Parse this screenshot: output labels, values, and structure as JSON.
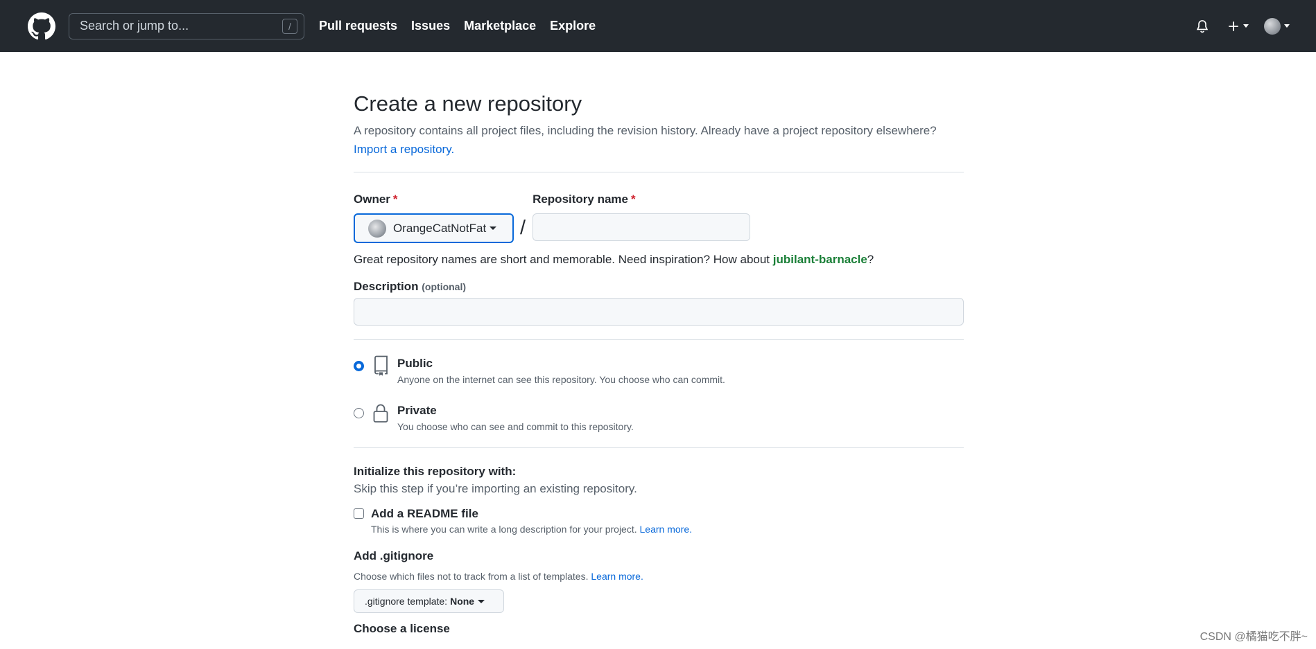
{
  "header": {
    "search_placeholder": "Search or jump to...",
    "search_shortcut": "/",
    "nav": [
      "Pull requests",
      "Issues",
      "Marketplace",
      "Explore"
    ],
    "plus_icon": "plus-icon",
    "bell_icon": "bell-icon"
  },
  "page": {
    "title": "Create a new repository",
    "subtitle": "A repository contains all project files, including the revision history. Already have a project repository elsewhere?",
    "import_link": "Import a repository."
  },
  "form": {
    "owner_label": "Owner",
    "required_mark": "*",
    "owner_value": "OrangeCatNotFat",
    "separator": "/",
    "repo_name_label": "Repository name",
    "repo_name_value": "",
    "hint_prefix": "Great repository names are short and memorable. Need inspiration? How about ",
    "hint_suggestion": "jubilant-barnacle",
    "hint_suffix": "?",
    "description_label": "Description",
    "description_optional": "(optional)",
    "description_value": ""
  },
  "visibility": {
    "selected": "public",
    "public_title": "Public",
    "public_desc": "Anyone on the internet can see this repository. You choose who can commit.",
    "private_title": "Private",
    "private_desc": "You choose who can see and commit to this repository."
  },
  "init": {
    "title": "Initialize this repository with:",
    "subtitle": "Skip this step if you’re importing an existing repository.",
    "readme_label": "Add a README file",
    "readme_checked": false,
    "readme_desc": "This is where you can write a long description for your project.",
    "learn_more": "Learn more.",
    "gitignore_title": "Add .gitignore",
    "gitignore_desc": "Choose which files not to track from a list of templates.",
    "gitignore_btn_prefix": ".gitignore template:",
    "gitignore_btn_value": "None",
    "license_title": "Choose a license"
  },
  "watermark": "CSDN @橘猫吃不胖~",
  "colors": {
    "header_bg": "#24292f",
    "link": "#0969da",
    "required": "#cf222e",
    "suggestion": "#1a7f37",
    "focus_border": "#0969da"
  }
}
